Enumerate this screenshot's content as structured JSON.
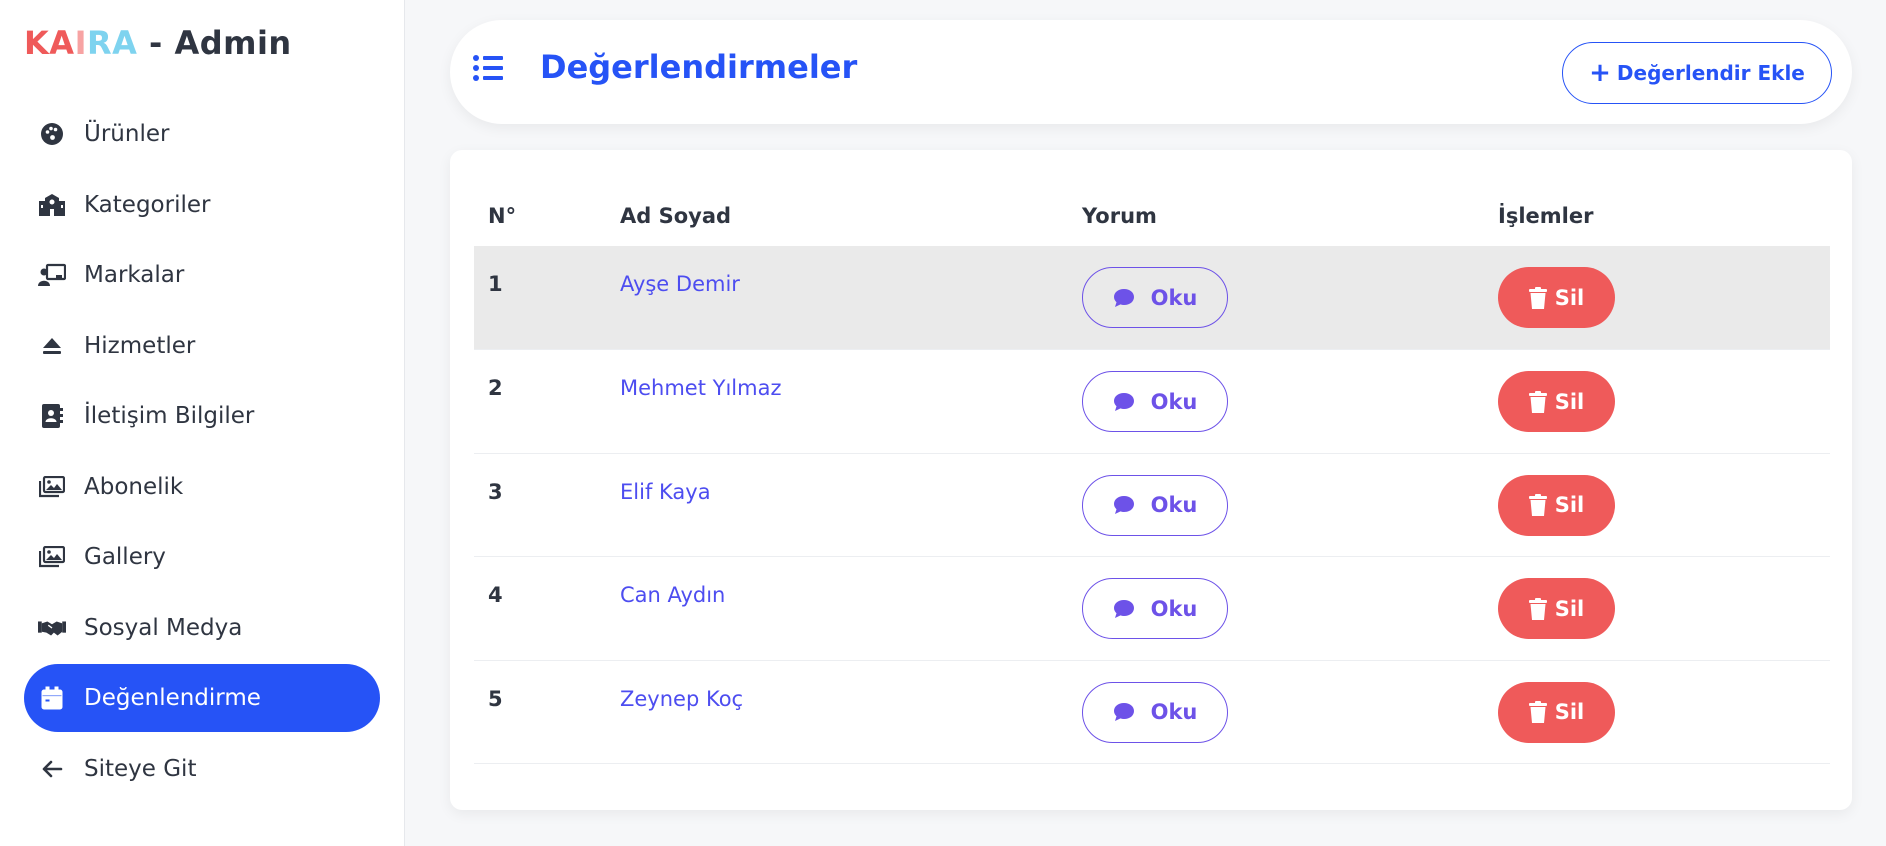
{
  "brand": {
    "part1": "KA",
    "part2": "I",
    "part3": "RA",
    "part4": " - Admin",
    "colors": {
      "red": "#ef5a5a",
      "pink": "#f7a3a3",
      "cyan": "#7ed3ef",
      "dark": "#2f3541"
    }
  },
  "sidebar": {
    "items": [
      {
        "label": "Ürünler",
        "icon": "palette-icon",
        "active": false
      },
      {
        "label": "Kategoriler",
        "icon": "school-icon",
        "active": false
      },
      {
        "label": "Markalar",
        "icon": "chalkboard-user-icon",
        "active": false
      },
      {
        "label": "Hizmetler",
        "icon": "eject-icon",
        "active": false
      },
      {
        "label": "İletişim Bilgiler",
        "icon": "address-book-icon",
        "active": false
      },
      {
        "label": "Abonelik",
        "icon": "images-icon",
        "active": false
      },
      {
        "label": "Gallery",
        "icon": "images-icon",
        "active": false
      },
      {
        "label": "Sosyal Medya",
        "icon": "handshake-icon",
        "active": false
      },
      {
        "label": "Değenlendirme",
        "icon": "calendar-icon",
        "active": true
      },
      {
        "label": "Siteye Git",
        "icon": "arrow-left-icon",
        "active": false
      }
    ]
  },
  "header": {
    "title": "Değerlendirmeler",
    "add_button": "Değerlendir Ekle",
    "menu_icon": "list-icon"
  },
  "table": {
    "columns": [
      "N°",
      "Ad Soyad",
      "Yorum",
      "İşlemler"
    ],
    "rows": [
      {
        "no": "1",
        "name": "Ayşe Demir",
        "read_label": "Oku",
        "delete_label": "Sil"
      },
      {
        "no": "2",
        "name": "Mehmet Yılmaz",
        "read_label": "Oku",
        "delete_label": "Sil"
      },
      {
        "no": "3",
        "name": "Elif Kaya",
        "read_label": "Oku",
        "delete_label": "Sil"
      },
      {
        "no": "4",
        "name": "Can Aydın",
        "read_label": "Oku",
        "delete_label": "Sil"
      },
      {
        "no": "5",
        "name": "Zeynep Koç",
        "read_label": "Oku",
        "delete_label": "Sil"
      }
    ]
  },
  "colors": {
    "accent": "#2653f6",
    "danger": "#ef5a5a",
    "read": "#6d52e8",
    "link": "#4d4df0",
    "row_highlight": "#eaeaea"
  }
}
